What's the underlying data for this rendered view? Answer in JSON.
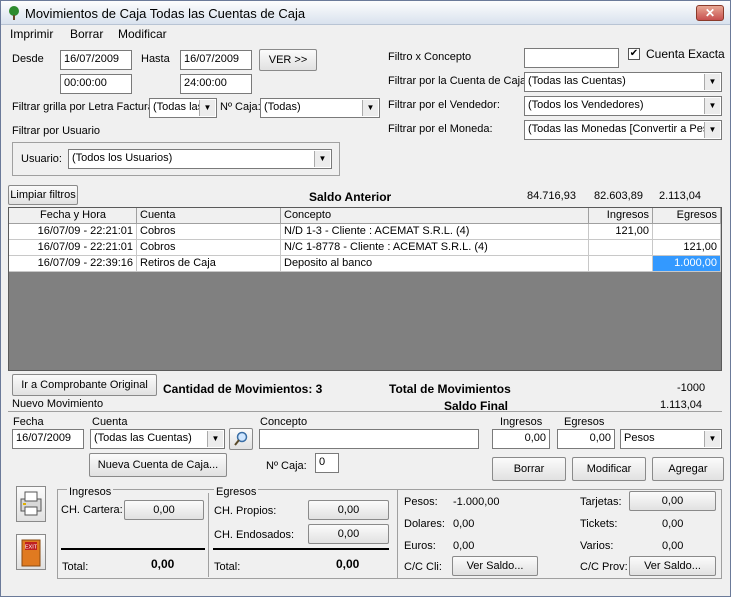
{
  "window": {
    "title": "Movimientos de Caja Todas las Cuentas de Caja",
    "close": "✕"
  },
  "menu": [
    "Imprimir",
    "Borrar",
    "Modificar"
  ],
  "filters": {
    "desde_label": "Desde",
    "desde": "16/07/2009",
    "desde_hora": "00:00:00",
    "hasta_label": "Hasta",
    "hasta": "16/07/2009",
    "hasta_hora": "24:00:00",
    "ver_button": "VER >>",
    "letra_label": "Filtrar grilla por Letra Factura:",
    "letra_value": "(Todas las",
    "caja_label": "Nº Caja:",
    "caja_value": "(Todas)",
    "usuario_group": "Filtrar por Usuario",
    "usuario_label": "Usuario:",
    "usuario_value": "(Todos los Usuarios)",
    "concepto_label": "Filtro x Concepto",
    "concepto_value": "",
    "cuenta_exacta_label": "Cuenta Exacta",
    "cuenta_exacta_checked": true,
    "cuenta_label": "Filtrar por la Cuenta de Caja:",
    "cuenta_value": "(Todas las Cuentas)",
    "vendedor_label": "Filtrar por el Vendedor:",
    "vendedor_value": "(Todos los Vendedores)",
    "moneda_label": "Filtrar por el Moneda:",
    "moneda_value": "(Todas las Monedas [Convertir a Peso"
  },
  "saldo_anterior": {
    "button": "Limpiar filtros",
    "label": "Saldo Anterior",
    "v1": "84.716,93",
    "v2": "82.603,89",
    "v3": "2.113,04"
  },
  "table": {
    "headers": [
      "Fecha y Hora",
      "Cuenta",
      "Concepto",
      "Ingresos",
      "Egresos"
    ],
    "rows": [
      [
        "16/07/09 - 22:21:01",
        "Cobros",
        "N/D 1-3 - Cliente : ACEMAT S.R.L. (4)",
        "121,00",
        ""
      ],
      [
        "16/07/09 - 22:21:01",
        "Cobros",
        "N/C 1-8778 - Cliente : ACEMAT S.R.L. (4)",
        "",
        "121,00"
      ],
      [
        "16/07/09 - 22:39:16",
        "Retiros de Caja",
        "Deposito al banco",
        "",
        "1.000,00"
      ]
    ]
  },
  "summary": {
    "ir_button": "Ir a Comprobante Original",
    "cantidad": "Cantidad de Movimientos: 3",
    "total_label": "Total de Movimientos",
    "total_value": "-1000",
    "saldo_final_label": "Saldo Final",
    "saldo_final_value": "1.113,04"
  },
  "nuevo": {
    "title": "Nuevo Movimiento",
    "fecha_label": "Fecha",
    "fecha": "16/07/2009",
    "cuenta_label": "Cuenta",
    "cuenta": "(Todas las Cuentas)",
    "concepto_label": "Concepto",
    "concepto": "",
    "ingresos_label": "Ingresos",
    "ingresos": "0,00",
    "egresos_label": "Egresos",
    "egresos": "0,00",
    "moneda": "Pesos",
    "nueva_cuenta_button": "Nueva Cuenta de Caja...",
    "caja_label": "Nº Caja:",
    "caja": "0",
    "borrar": "Borrar",
    "modificar": "Modificar",
    "agregar": "Agregar"
  },
  "bottom": {
    "ingresos_title": "Ingresos",
    "ch_cartera_label": "CH. Cartera:",
    "ch_cartera": "0,00",
    "ingresos_total_label": "Total:",
    "ingresos_total": "0,00",
    "egresos_title": "Egresos",
    "ch_propios_label": "CH. Propios:",
    "ch_propios": "0,00",
    "ch_endosados_label": "CH. Endosados:",
    "ch_endosados": "0,00",
    "egresos_total_label": "Total:",
    "egresos_total": "0,00",
    "pesos_label": "Pesos:",
    "pesos": "-1.000,00",
    "dolares_label": "Dolares:",
    "dolares": "0,00",
    "euros_label": "Euros:",
    "euros": "0,00",
    "cc_cli_label": "C/C Cli:",
    "cc_cli_button": "Ver Saldo...",
    "tarjetas_label": "Tarjetas:",
    "tarjetas": "0,00",
    "tickets_label": "Tickets:",
    "tickets": "0,00",
    "varios_label": "Varios:",
    "varios": "0,00",
    "cc_prov_label": "C/C Prov:",
    "cc_prov_button": "Ver Saldo...",
    "exit_text": "EXIT"
  }
}
